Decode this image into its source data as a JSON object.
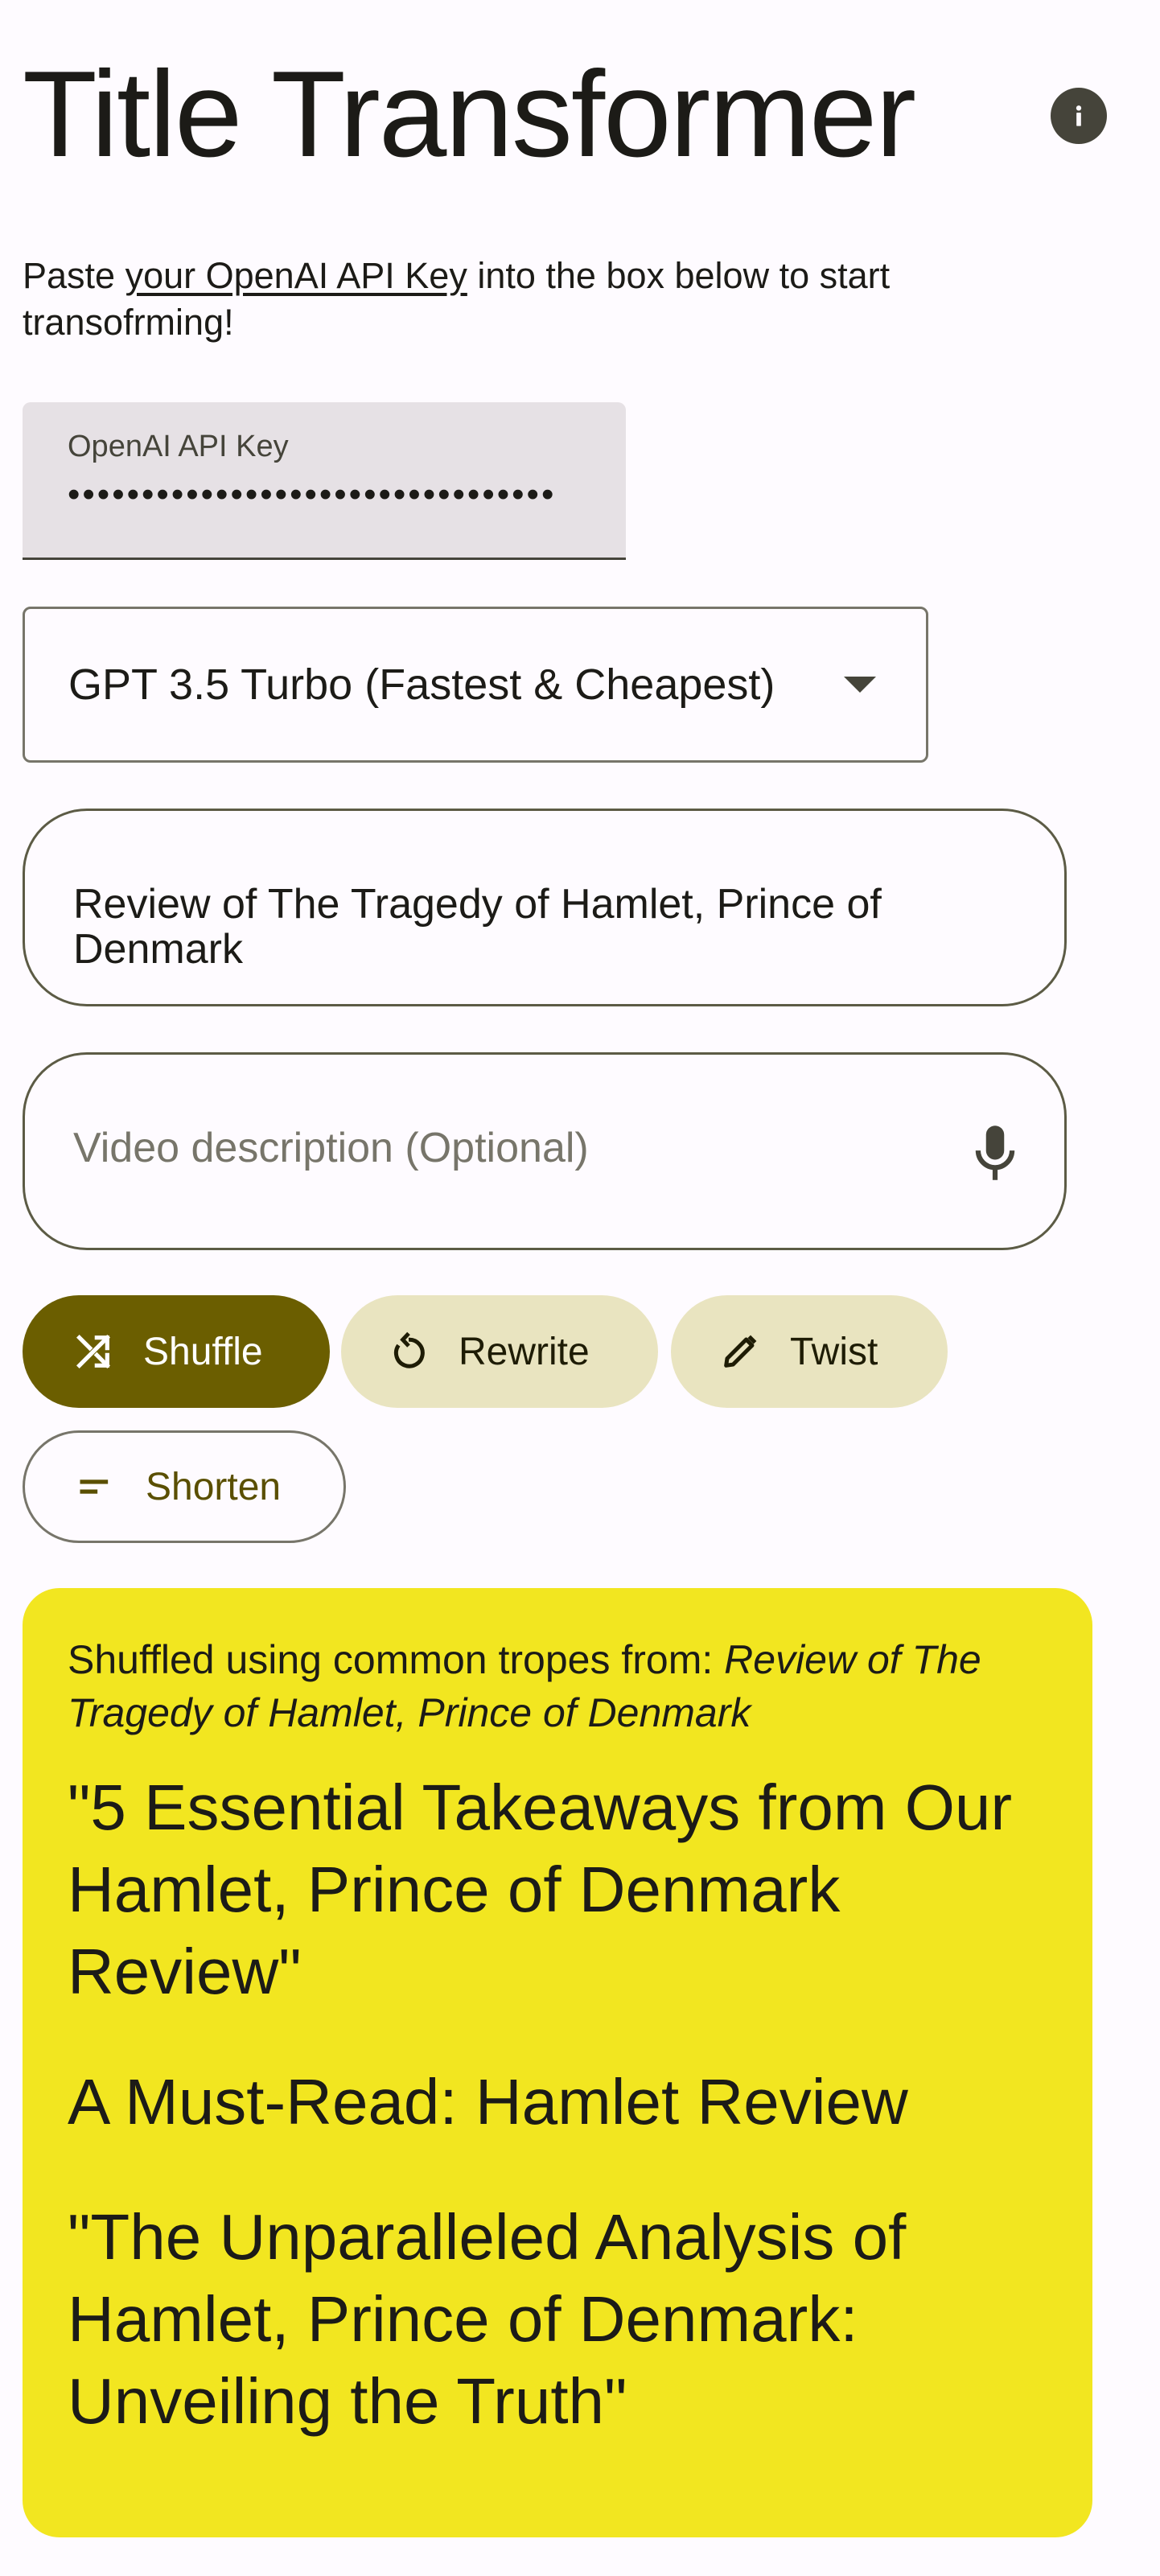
{
  "header": {
    "title": "Title Transformer",
    "info_icon": "info-icon"
  },
  "intro": {
    "prefix": "Paste ",
    "link_text": "your OpenAI API Key",
    "suffix": " into the box below to start transofrming!"
  },
  "api_key": {
    "label": "OpenAI API Key",
    "value": "•••••••••••••••••••••••••••••••••"
  },
  "model": {
    "selected": "GPT 3.5 Turbo (Fastest & Cheapest)"
  },
  "title_input": {
    "value": "Review of The Tragedy of Hamlet, Prince of Denmark"
  },
  "description_input": {
    "placeholder": "Video description (Optional)",
    "icon": "microphone-icon"
  },
  "actions": {
    "shuffle": "Shuffle",
    "rewrite": "Rewrite",
    "twist": "Twist",
    "shorten": "Shorten"
  },
  "results": {
    "source_prefix": "Shuffled using common tropes from: ",
    "source_title": "Review of The Tragedy of Hamlet, Prince of Denmark",
    "items": [
      "\"5 Essential Takeaways from Our Hamlet, Prince of Denmark Review\"",
      "A Must-Read: Hamlet Review",
      "\"The Unparalleled Analysis of Hamlet, Prince of Denmark: Unveiling the Truth\""
    ]
  },
  "colors": {
    "primary": "#6b5e00",
    "secondary_container": "#e9e4c0",
    "result_background": "#f2e620",
    "background": "#fefbff"
  }
}
